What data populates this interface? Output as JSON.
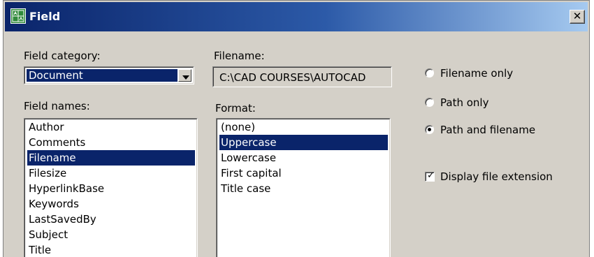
{
  "window": {
    "title": "Field",
    "close_label": "✕"
  },
  "field_category": {
    "label": "Field category:",
    "selected": "Document"
  },
  "filename": {
    "label": "Filename:",
    "value": "C:\\CAD COURSES\\AUTOCAD"
  },
  "field_names": {
    "label": "Field names:",
    "items": [
      "Author",
      "Comments",
      "Filename",
      "Filesize",
      "HyperlinkBase",
      "Keywords",
      "LastSavedBy",
      "Subject",
      "Title"
    ],
    "selected": "Filename"
  },
  "format": {
    "label": "Format:",
    "items": [
      "(none)",
      "Uppercase",
      "Lowercase",
      "First capital",
      "Title case"
    ],
    "selected": "Uppercase"
  },
  "options": {
    "radio_filename_only": "Filename only",
    "radio_path_only": "Path only",
    "radio_path_and_filename": "Path and filename",
    "selected_radio": "Path and filename",
    "display_extension_label": "Display file extension",
    "display_extension_checked": true
  },
  "colors": {
    "selection": "#0a246a",
    "face": "#d4d0c8",
    "title_start": "#0a246a",
    "title_end": "#a6caf0"
  }
}
